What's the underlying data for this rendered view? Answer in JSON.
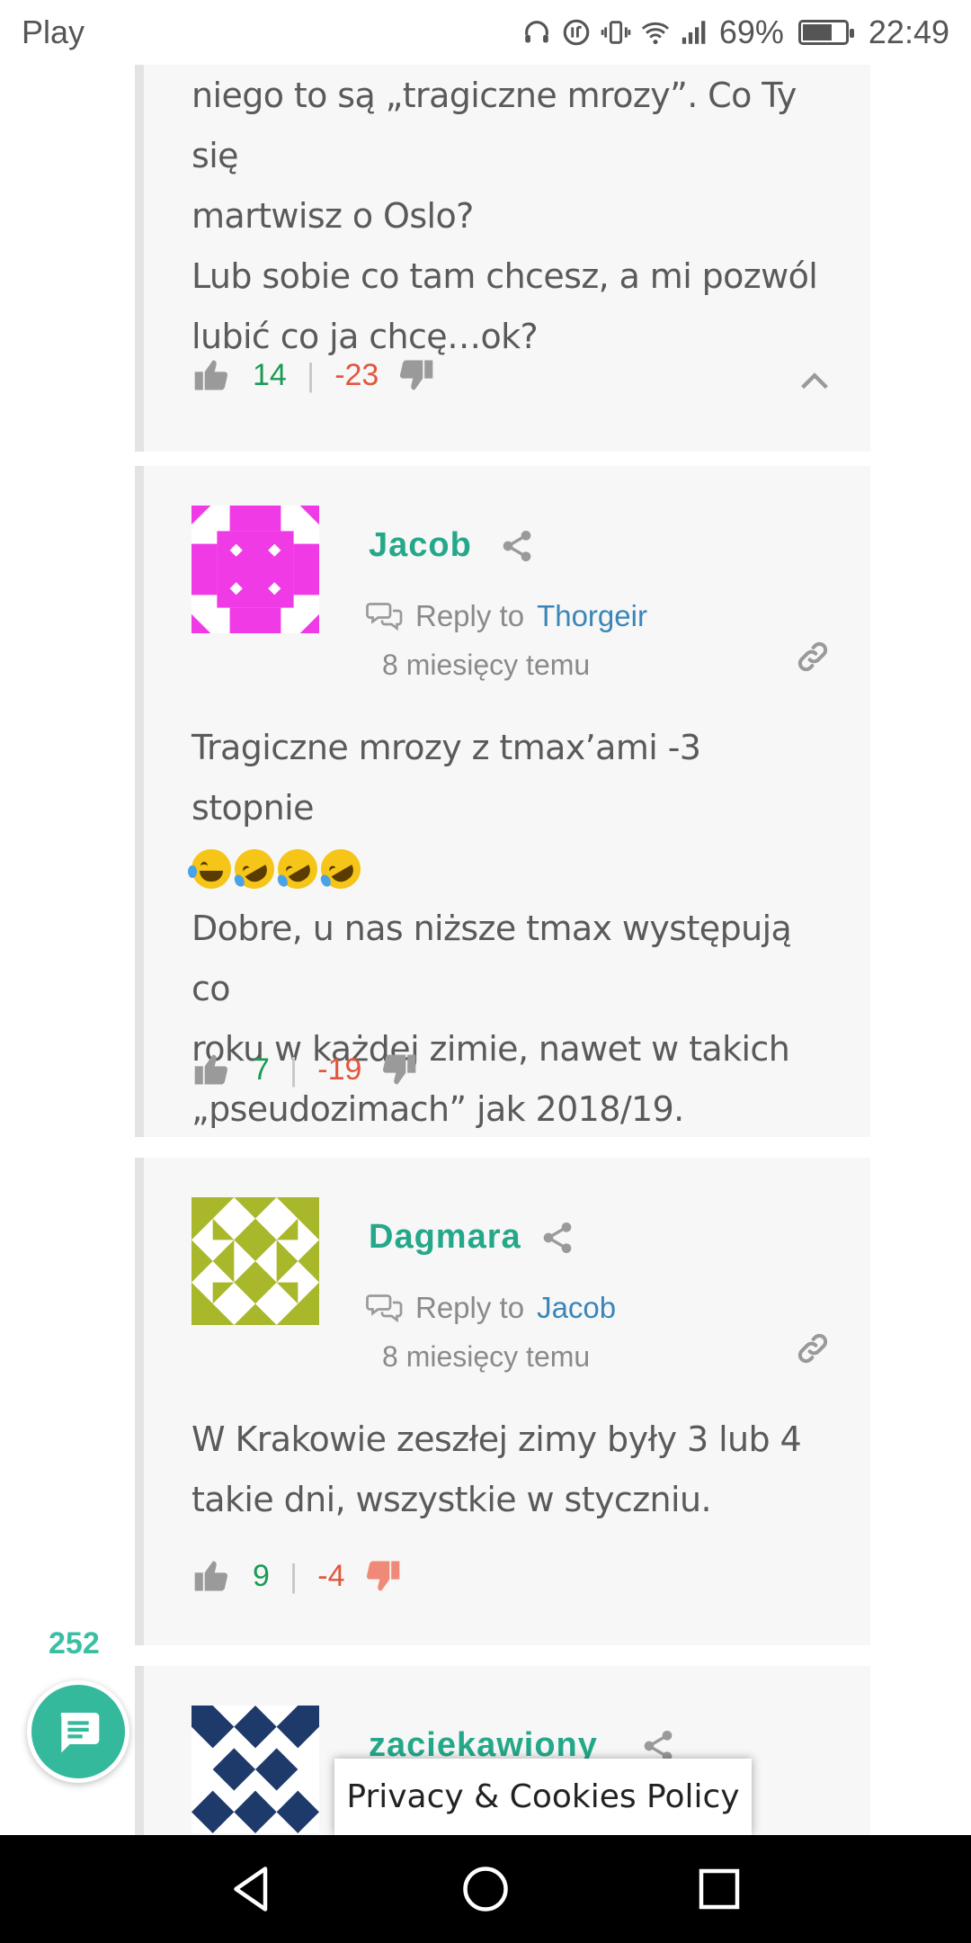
{
  "status_bar": {
    "carrier": "Play",
    "battery": "69%",
    "time": "22:49",
    "battery_level": 0.69
  },
  "comments": [
    {
      "text_lines": [
        "niego to są „tragiczne mrozy”. Co Ty się",
        "martwisz o Oslo?",
        "Lub sobie co tam chcesz, a mi pozwól",
        "lubić co ja chcę…ok?"
      ],
      "upvotes": "14",
      "downvotes": "-23"
    },
    {
      "author": "Jacob",
      "reply_to_label": "Reply to",
      "reply_to": "Thorgeir",
      "time": "8 miesięcy temu",
      "text_line_1": "Tragiczne mrozy z tmax’ami -3 stopnie",
      "emojis": [
        "face-with-tears-of-joy",
        "rolling-on-the-floor-laughing",
        "rolling-on-the-floor-laughing",
        "rolling-on-the-floor-laughing"
      ],
      "text_lines_after": [
        "Dobre, u nas niższe tmax występują co",
        "roku w każdej zimie, nawet w takich",
        "„pseudozimach” jak 2018/19."
      ],
      "upvotes": "7",
      "downvotes": "-19",
      "avatar_color": "#f03ae6"
    },
    {
      "author": "Dagmara",
      "reply_to_label": "Reply to",
      "reply_to": "Jacob",
      "time": "8 miesięcy temu",
      "text_lines": [
        "W Krakowie zeszłej zimy były 3 lub 4",
        "takie dni, wszystkie w styczniu."
      ],
      "upvotes": "9",
      "downvotes": "-4",
      "avatar_color": "#a8b82a"
    },
    {
      "author": "zaciekawiony",
      "avatar_color": "#1e3a6b"
    }
  ],
  "comments_fab": {
    "count": "252",
    "icon": "chat-bubble-icon"
  },
  "privacy_bar": {
    "label": "Privacy & Cookies Policy"
  },
  "colors": {
    "accent": "#35b99c",
    "author": "#25a88a",
    "link": "#3a86b8",
    "upvote": "#1a9b55",
    "downvote": "#e2563d"
  }
}
